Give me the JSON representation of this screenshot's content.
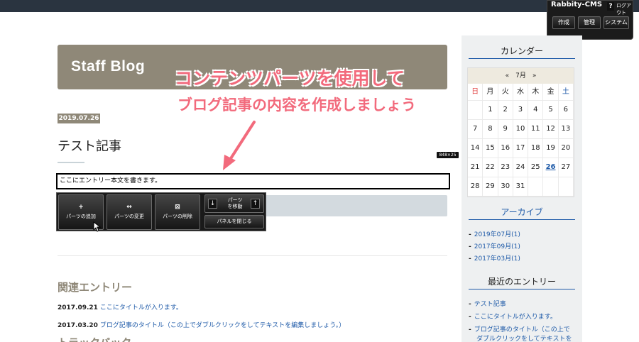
{
  "cms": {
    "logo": "Rabbity-CMS",
    "help": "?",
    "logout": "ログアウト",
    "buttons": [
      "作成",
      "管理",
      "システム"
    ]
  },
  "site": {
    "title": "Staff Blog"
  },
  "annotation": {
    "line1": "コンテンツパーツを使用して",
    "line2": "ブログ記事の内容を作成しましょう"
  },
  "post": {
    "date": "2019.07.26",
    "title": "テスト記事",
    "size_badge": "848×25",
    "body": "ここにエントリー本文を書きます。"
  },
  "parts_toolbar": {
    "add": {
      "icon": "+",
      "label": "パーツの追加"
    },
    "change": {
      "icon": "↔",
      "label": "パーツの変更"
    },
    "delete": {
      "icon": "⊠",
      "label": "パーツの削除"
    },
    "move_label_1": "パーツ",
    "move_label_2": "を移動",
    "move_down": "↓",
    "move_up": "↑",
    "close": "パネルを閉じる"
  },
  "related": {
    "heading": "関連エントリー",
    "items": [
      {
        "date": "2017.09.21",
        "title": "ここにタイトルが入ります。"
      },
      {
        "date": "2017.03.20",
        "title": "ブログ記事のタイトル（この上でダブルクリックをしてテキストを編集しましょう。）"
      }
    ],
    "trackback_heading": "トラックバック"
  },
  "sidebar": {
    "calendar": {
      "heading": "カレンダー",
      "month_label": "«　7月　»",
      "dow": [
        "日",
        "月",
        "火",
        "水",
        "木",
        "金",
        "土"
      ],
      "weeks": [
        [
          "",
          "1",
          "2",
          "3",
          "4",
          "5",
          "6"
        ],
        [
          "7",
          "8",
          "9",
          "10",
          "11",
          "12",
          "13"
        ],
        [
          "14",
          "15",
          "16",
          "17",
          "18",
          "19",
          "20"
        ],
        [
          "21",
          "22",
          "23",
          "24",
          "25",
          "26",
          "27"
        ],
        [
          "28",
          "29",
          "30",
          "31",
          "",
          "",
          ""
        ]
      ],
      "highlight": "26"
    },
    "archive": {
      "heading": "アーカイブ",
      "items": [
        "2019年07月(1)",
        "2017年09月(1)",
        "2017年03月(1)"
      ]
    },
    "recent": {
      "heading": "最近のエントリー",
      "items": [
        "テスト記事",
        "ここにタイトルが入ります。",
        "ブログ記事のタイトル（この上で",
        "ダブルクリックをしてテキストを"
      ]
    }
  }
}
